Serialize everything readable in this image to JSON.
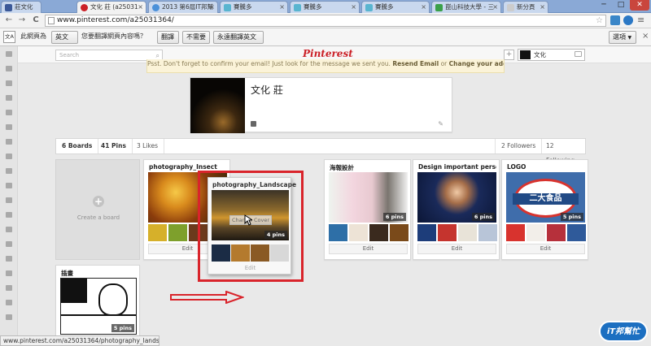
{
  "browser": {
    "tabs": [
      {
        "label": "莊文化",
        "color": "#3b5998"
      },
      {
        "label": "文化 莊 (a25031",
        "color": "#cb2027"
      },
      {
        "label": "2013 第6屆IT邦幫",
        "color": "#4a90d9"
      },
      {
        "label": "賽騰多",
        "color": "#59b5d0"
      },
      {
        "label": "賽騰多",
        "color": "#59b5d0"
      },
      {
        "label": "賽騰多",
        "color": "#59b5d0"
      },
      {
        "label": "崑山科技大學 - 三",
        "color": "#3aa04a"
      },
      {
        "label": "新分頁",
        "color": "#cccccc"
      }
    ],
    "window_controls": {
      "minimize": "─",
      "maximize": "□",
      "close": "✕"
    },
    "url": "www.pinterest.com/a25031364/",
    "nav": {
      "back": "←",
      "forward": "→",
      "reload": "C"
    }
  },
  "translate_bar": {
    "icon": "文A",
    "page_is_in": "此網頁為",
    "language": "英文",
    "question": "您要翻譯網頁內容嗎？",
    "translate_button": "翻譯",
    "nope_button": "不需要",
    "always_button": "永遠翻譯英文",
    "options_button": "選項"
  },
  "pinterest": {
    "search_placeholder": "Search",
    "logo": "Pinterest",
    "username": "文化",
    "notice_text": "Psst. Don't forget to confirm your email! Just look for the message we sent you.",
    "notice_resend": "Resend Email",
    "notice_or": "or",
    "notice_change": "Change your address.",
    "profile_name": "文化 莊",
    "stats": {
      "boards": "6 Boards",
      "pins": "41 Pins",
      "likes": "3 Likes",
      "followers": "2 Followers",
      "following": "12 Following"
    },
    "create_board": "Create a board",
    "boards": [
      {
        "title": "photography_Insect",
        "pins": "",
        "edit": "Edit"
      },
      {
        "title": "海報設計",
        "pins": "6 pins",
        "edit": "Edit"
      },
      {
        "title": "Design important person ...",
        "pins": "6 pins",
        "edit": "Edit"
      },
      {
        "title": "LOGO",
        "pins": "5 pins",
        "edit": "Edit"
      },
      {
        "title": "插畫",
        "pins": "5 pins",
        "edit": ""
      }
    ],
    "dragged_board": {
      "title": "photography_Landscape",
      "change_cover": "Change Cover",
      "pins": "4 pins",
      "edit": "Edit"
    },
    "logo_board_text": "二大食品"
  },
  "status_url": "www.pinterest.com/a25031364/photography_landscape/",
  "watermark": "iT邦幫忙",
  "colors": {
    "accent": "#cb2027",
    "highlight": "#d9242b"
  }
}
